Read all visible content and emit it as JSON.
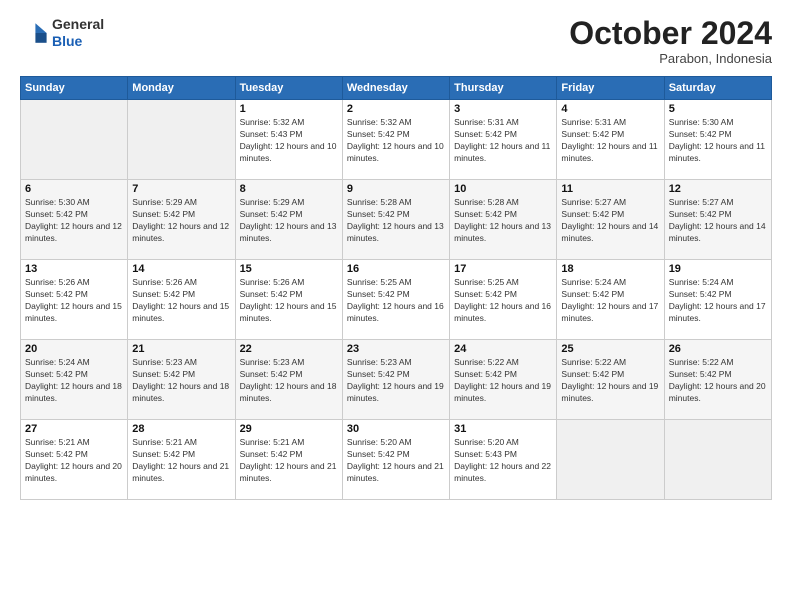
{
  "logo": {
    "line1": "General",
    "line2": "Blue"
  },
  "header": {
    "month": "October 2024",
    "location": "Parabon, Indonesia"
  },
  "days_of_week": [
    "Sunday",
    "Monday",
    "Tuesday",
    "Wednesday",
    "Thursday",
    "Friday",
    "Saturday"
  ],
  "weeks": [
    [
      {
        "day": "",
        "info": ""
      },
      {
        "day": "",
        "info": ""
      },
      {
        "day": "1",
        "info": "Sunrise: 5:32 AM\nSunset: 5:43 PM\nDaylight: 12 hours and 10 minutes."
      },
      {
        "day": "2",
        "info": "Sunrise: 5:32 AM\nSunset: 5:42 PM\nDaylight: 12 hours and 10 minutes."
      },
      {
        "day": "3",
        "info": "Sunrise: 5:31 AM\nSunset: 5:42 PM\nDaylight: 12 hours and 11 minutes."
      },
      {
        "day": "4",
        "info": "Sunrise: 5:31 AM\nSunset: 5:42 PM\nDaylight: 12 hours and 11 minutes."
      },
      {
        "day": "5",
        "info": "Sunrise: 5:30 AM\nSunset: 5:42 PM\nDaylight: 12 hours and 11 minutes."
      }
    ],
    [
      {
        "day": "6",
        "info": "Sunrise: 5:30 AM\nSunset: 5:42 PM\nDaylight: 12 hours and 12 minutes."
      },
      {
        "day": "7",
        "info": "Sunrise: 5:29 AM\nSunset: 5:42 PM\nDaylight: 12 hours and 12 minutes."
      },
      {
        "day": "8",
        "info": "Sunrise: 5:29 AM\nSunset: 5:42 PM\nDaylight: 12 hours and 13 minutes."
      },
      {
        "day": "9",
        "info": "Sunrise: 5:28 AM\nSunset: 5:42 PM\nDaylight: 12 hours and 13 minutes."
      },
      {
        "day": "10",
        "info": "Sunrise: 5:28 AM\nSunset: 5:42 PM\nDaylight: 12 hours and 13 minutes."
      },
      {
        "day": "11",
        "info": "Sunrise: 5:27 AM\nSunset: 5:42 PM\nDaylight: 12 hours and 14 minutes."
      },
      {
        "day": "12",
        "info": "Sunrise: 5:27 AM\nSunset: 5:42 PM\nDaylight: 12 hours and 14 minutes."
      }
    ],
    [
      {
        "day": "13",
        "info": "Sunrise: 5:26 AM\nSunset: 5:42 PM\nDaylight: 12 hours and 15 minutes."
      },
      {
        "day": "14",
        "info": "Sunrise: 5:26 AM\nSunset: 5:42 PM\nDaylight: 12 hours and 15 minutes."
      },
      {
        "day": "15",
        "info": "Sunrise: 5:26 AM\nSunset: 5:42 PM\nDaylight: 12 hours and 15 minutes."
      },
      {
        "day": "16",
        "info": "Sunrise: 5:25 AM\nSunset: 5:42 PM\nDaylight: 12 hours and 16 minutes."
      },
      {
        "day": "17",
        "info": "Sunrise: 5:25 AM\nSunset: 5:42 PM\nDaylight: 12 hours and 16 minutes."
      },
      {
        "day": "18",
        "info": "Sunrise: 5:24 AM\nSunset: 5:42 PM\nDaylight: 12 hours and 17 minutes."
      },
      {
        "day": "19",
        "info": "Sunrise: 5:24 AM\nSunset: 5:42 PM\nDaylight: 12 hours and 17 minutes."
      }
    ],
    [
      {
        "day": "20",
        "info": "Sunrise: 5:24 AM\nSunset: 5:42 PM\nDaylight: 12 hours and 18 minutes."
      },
      {
        "day": "21",
        "info": "Sunrise: 5:23 AM\nSunset: 5:42 PM\nDaylight: 12 hours and 18 minutes."
      },
      {
        "day": "22",
        "info": "Sunrise: 5:23 AM\nSunset: 5:42 PM\nDaylight: 12 hours and 18 minutes."
      },
      {
        "day": "23",
        "info": "Sunrise: 5:23 AM\nSunset: 5:42 PM\nDaylight: 12 hours and 19 minutes."
      },
      {
        "day": "24",
        "info": "Sunrise: 5:22 AM\nSunset: 5:42 PM\nDaylight: 12 hours and 19 minutes."
      },
      {
        "day": "25",
        "info": "Sunrise: 5:22 AM\nSunset: 5:42 PM\nDaylight: 12 hours and 19 minutes."
      },
      {
        "day": "26",
        "info": "Sunrise: 5:22 AM\nSunset: 5:42 PM\nDaylight: 12 hours and 20 minutes."
      }
    ],
    [
      {
        "day": "27",
        "info": "Sunrise: 5:21 AM\nSunset: 5:42 PM\nDaylight: 12 hours and 20 minutes."
      },
      {
        "day": "28",
        "info": "Sunrise: 5:21 AM\nSunset: 5:42 PM\nDaylight: 12 hours and 21 minutes."
      },
      {
        "day": "29",
        "info": "Sunrise: 5:21 AM\nSunset: 5:42 PM\nDaylight: 12 hours and 21 minutes."
      },
      {
        "day": "30",
        "info": "Sunrise: 5:20 AM\nSunset: 5:42 PM\nDaylight: 12 hours and 21 minutes."
      },
      {
        "day": "31",
        "info": "Sunrise: 5:20 AM\nSunset: 5:43 PM\nDaylight: 12 hours and 22 minutes."
      },
      {
        "day": "",
        "info": ""
      },
      {
        "day": "",
        "info": ""
      }
    ]
  ]
}
